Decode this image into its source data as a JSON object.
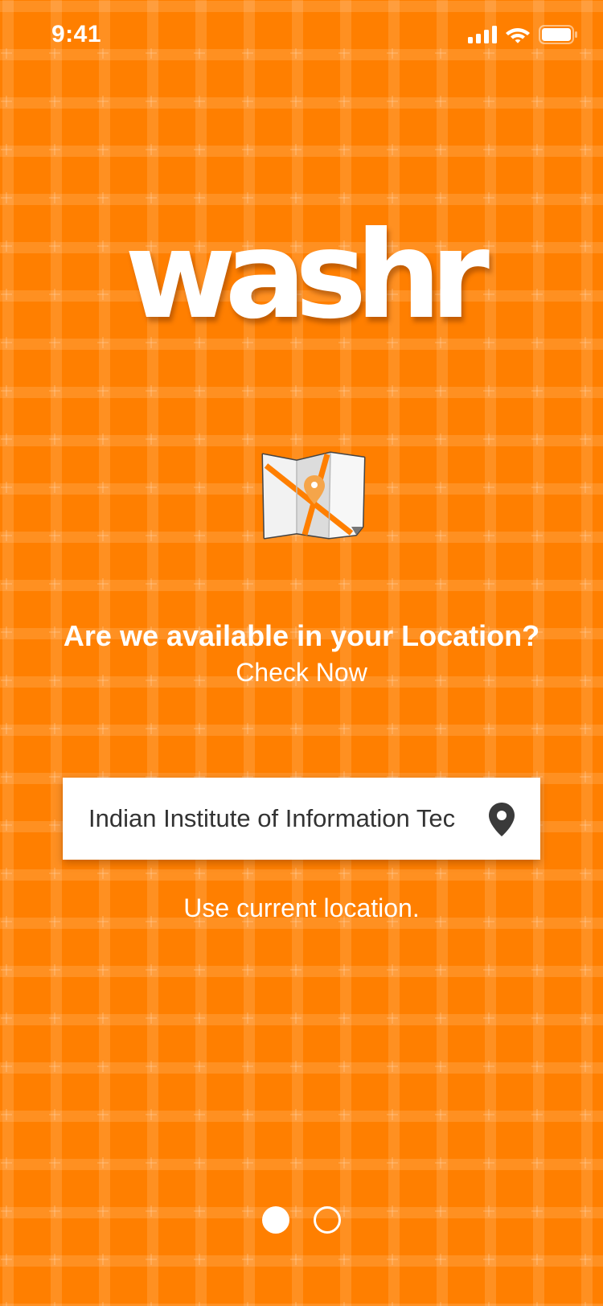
{
  "status_bar": {
    "time": "9:41",
    "icons": [
      "signal-icon",
      "wifi-icon",
      "battery-icon"
    ]
  },
  "brand": {
    "logo_text": "washr",
    "accent_color": "#FF7F00"
  },
  "illustration": {
    "icon": "map-icon"
  },
  "prompt": {
    "headline": "Are we available in your Location?",
    "subheadline": "Check Now"
  },
  "location": {
    "value": "Indian Institute of Information Tec",
    "icon": "location-pin-icon",
    "use_current_label": "Use current location."
  },
  "pager": {
    "total": 2,
    "active_index": 0
  }
}
